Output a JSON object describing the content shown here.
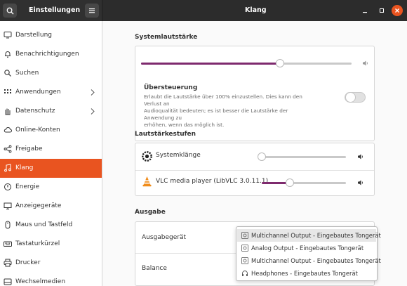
{
  "header": {
    "app_title": "Einstellungen",
    "panel_title": "Klang"
  },
  "sidebar": {
    "items": [
      {
        "label": "Darstellung",
        "icon": "display-icon"
      },
      {
        "label": "Benachrichtigungen",
        "icon": "bell-icon"
      },
      {
        "label": "Suchen",
        "icon": "search-icon"
      },
      {
        "label": "Anwendungen",
        "icon": "apps-grid-icon"
      },
      {
        "label": "Datenschutz",
        "icon": "hand-icon"
      },
      {
        "label": "Online-Konten",
        "icon": "cloud-icon"
      },
      {
        "label": "Freigabe",
        "icon": "share-icon"
      },
      {
        "label": "Klang",
        "icon": "music-note-icon"
      },
      {
        "label": "Energie",
        "icon": "power-icon"
      },
      {
        "label": "Anzeigegeräte",
        "icon": "monitor-icon"
      },
      {
        "label": "Maus und Tastfeld",
        "icon": "mouse-icon"
      },
      {
        "label": "Tastaturkürzel",
        "icon": "keyboard-icon"
      },
      {
        "label": "Drucker",
        "icon": "printer-icon"
      },
      {
        "label": "Wechselmedien",
        "icon": "media-icon"
      }
    ],
    "active_index": 7
  },
  "system_volume": {
    "heading": "Systemlautstärke",
    "level": 0.66
  },
  "overamplification": {
    "title": "Übersteuerung",
    "description_lines": [
      "Erlaubt die Lautstärke über 100% einzustellen. Dies kann den Verlust an",
      "Audioqualität bedeuten; es ist besser die Lautstärke der Anwendung zu",
      "erhöhen, wenn das möglich ist."
    ],
    "enabled": false
  },
  "volume_levels": {
    "heading": "Lautstärkestufen",
    "apps": [
      {
        "name": "Systemklänge",
        "icon": "system-sounds-icon",
        "level": 0.0
      },
      {
        "name": "VLC media player (LibVLC 3.0.11.1)",
        "icon": "vlc-icon",
        "level": 0.33
      }
    ]
  },
  "output": {
    "heading": "Ausgabe",
    "device_label": "Ausgabegerät",
    "balance_label": "Balance",
    "device_options": [
      {
        "label": "Multichannel Output - Eingebautes Tongerät",
        "selected": true
      },
      {
        "label": "Analog Output - Eingebautes Tongerät",
        "selected": false
      },
      {
        "label": "Multichannel Output - Eingebautes Tongerät",
        "selected": false
      },
      {
        "label": "Headphones - Eingebautes Tongerät",
        "selected": false
      }
    ]
  },
  "colors": {
    "accent": "#e95420",
    "slider_fill": "#7e2a6e",
    "header_bg": "#2c2c2c"
  }
}
